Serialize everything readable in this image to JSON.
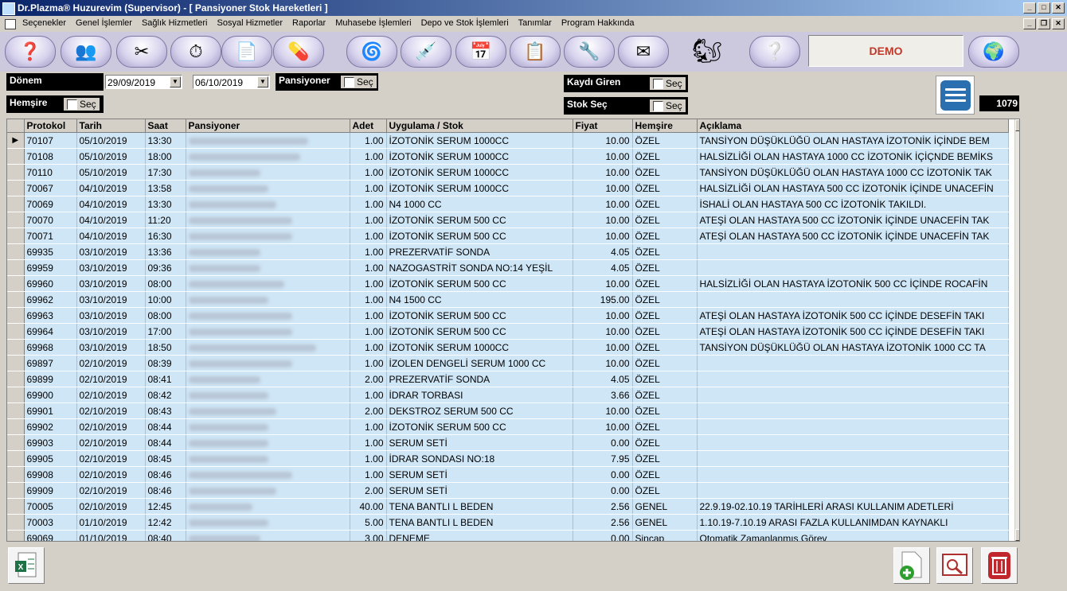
{
  "window": {
    "title": "Dr.Plazma® Huzurevim (Supervisor) - [ Pansiyoner Stok Hareketleri ]"
  },
  "menu": [
    "Seçenekler",
    "Genel İşlemler",
    "Sağlık Hizmetleri",
    "Sosyal Hizmetler",
    "Raporlar",
    "Muhasebe İşlemleri",
    "Depo ve Stok İşlemleri",
    "Tanımlar",
    "Program Hakkında"
  ],
  "toolbar": {
    "demo_label": "DEMO"
  },
  "filters": {
    "donem_label": "Dönem",
    "date_from": "29/09/2019",
    "date_to": "06/10/2019",
    "pansiyoner_label": "Pansiyoner",
    "hemsire_label": "Hemşire",
    "kaydi_giren_label": "Kaydı Giren",
    "stok_sec_label": "Stok Seç",
    "sec_label": "Seç"
  },
  "record_count": "1079",
  "grid": {
    "columns": [
      "Protokol",
      "Tarih",
      "Saat",
      "Pansiyoner",
      "Adet",
      "Uygulama / Stok",
      "Fiyat",
      "Hemşire",
      "Açıklama"
    ],
    "rows": [
      [
        "70107",
        "05/10/2019",
        "13:30",
        "",
        "1.00",
        "İZOTONİK SERUM 1000CC",
        "10.00",
        "ÖZEL",
        "TANSİYON DÜŞÜKLÜĞÜ OLAN HASTAYA İZOTONİK İÇİNDE BEM"
      ],
      [
        "70108",
        "05/10/2019",
        "18:00",
        "",
        "1.00",
        "İZOTONİK SERUM 1000CC",
        "10.00",
        "ÖZEL",
        "HALSİZLİĞİ OLAN HASTAYA 1000 CC İZOTONİK İÇİÇNDE BEMİKS"
      ],
      [
        "70110",
        "05/10/2019",
        "17:30",
        "",
        "1.00",
        "İZOTONİK SERUM 1000CC",
        "10.00",
        "ÖZEL",
        "TANSİYON DÜŞÜKLÜĞÜ OLAN HASTAYA 1000 CC İZOTONİK TAK"
      ],
      [
        "70067",
        "04/10/2019",
        "13:58",
        "",
        "1.00",
        "İZOTONİK SERUM 1000CC",
        "10.00",
        "ÖZEL",
        "HALSİZLİĞİ OLAN HASTAYA 500 CC İZOTONİK İÇİNDE UNACEFİN"
      ],
      [
        "70069",
        "04/10/2019",
        "13:30",
        "",
        "1.00",
        "N4 1000 CC",
        "10.00",
        "ÖZEL",
        "İSHALİ OLAN HASTAYA 500 CC İZOTONİK TAKILDI."
      ],
      [
        "70070",
        "04/10/2019",
        "11:20",
        "",
        "1.00",
        "İZOTONİK SERUM 500 CC",
        "10.00",
        "ÖZEL",
        "ATEŞİ OLAN HASTAYA 500 CC İZOTONİK İÇİNDE UNACEFİN TAK"
      ],
      [
        "70071",
        "04/10/2019",
        "16:30",
        "",
        "1.00",
        "İZOTONİK SERUM 500 CC",
        "10.00",
        "ÖZEL",
        "ATEŞİ OLAN HASTAYA 500 CC İZOTONİK İÇİNDE UNACEFİN TAK"
      ],
      [
        "69935",
        "03/10/2019",
        "13:36",
        "",
        "1.00",
        "PREZERVATİF SONDA",
        "4.05",
        "ÖZEL",
        ""
      ],
      [
        "69959",
        "03/10/2019",
        "09:36",
        "",
        "1.00",
        "NAZOGASTRİT SONDA NO:14 YEŞİL",
        "4.05",
        "ÖZEL",
        ""
      ],
      [
        "69960",
        "03/10/2019",
        "08:00",
        "",
        "1.00",
        "İZOTONİK SERUM 500 CC",
        "10.00",
        "ÖZEL",
        "HALSİZLİĞİ OLAN HASTAYA İZOTONİK 500 CC İÇİNDE ROCAFİN"
      ],
      [
        "69962",
        "03/10/2019",
        "10:00",
        "",
        "1.00",
        "N4 1500 CC",
        "195.00",
        "ÖZEL",
        ""
      ],
      [
        "69963",
        "03/10/2019",
        "08:00",
        "",
        "1.00",
        "İZOTONİK SERUM 500 CC",
        "10.00",
        "ÖZEL",
        "ATEŞİ OLAN HASTAYA İZOTONİK 500 CC İÇİNDE DESEFİN TAKI"
      ],
      [
        "69964",
        "03/10/2019",
        "17:00",
        "",
        "1.00",
        "İZOTONİK SERUM 500 CC",
        "10.00",
        "ÖZEL",
        "ATEŞİ OLAN HASTAYA İZOTONİK 500 CC İÇİNDE DESEFİN TAKI"
      ],
      [
        "69968",
        "03/10/2019",
        "18:50",
        "",
        "1.00",
        "İZOTONİK SERUM 1000CC",
        "10.00",
        "ÖZEL",
        "TANSİYON DÜŞÜKLÜĞÜ OLAN HASTAYA İZOTONİK 1000 CC TA"
      ],
      [
        "69897",
        "02/10/2019",
        "08:39",
        "",
        "1.00",
        "İZOLEN DENGELİ SERUM 1000 CC",
        "10.00",
        "ÖZEL",
        ""
      ],
      [
        "69899",
        "02/10/2019",
        "08:41",
        "",
        "2.00",
        "PREZERVATİF SONDA",
        "4.05",
        "ÖZEL",
        ""
      ],
      [
        "69900",
        "02/10/2019",
        "08:42",
        "",
        "1.00",
        "İDRAR TORBASI",
        "3.66",
        "ÖZEL",
        ""
      ],
      [
        "69901",
        "02/10/2019",
        "08:43",
        "",
        "2.00",
        "DEKSTROZ SERUM 500 CC",
        "10.00",
        "ÖZEL",
        ""
      ],
      [
        "69902",
        "02/10/2019",
        "08:44",
        "",
        "1.00",
        "İZOTONİK SERUM 500 CC",
        "10.00",
        "ÖZEL",
        ""
      ],
      [
        "69903",
        "02/10/2019",
        "08:44",
        "",
        "1.00",
        "SERUM SETİ",
        "0.00",
        "ÖZEL",
        ""
      ],
      [
        "69905",
        "02/10/2019",
        "08:45",
        "",
        "1.00",
        "İDRAR SONDASI NO:18",
        "7.95",
        "ÖZEL",
        ""
      ],
      [
        "69908",
        "02/10/2019",
        "08:46",
        "",
        "1.00",
        "SERUM SETİ",
        "0.00",
        "ÖZEL",
        ""
      ],
      [
        "69909",
        "02/10/2019",
        "08:46",
        "",
        "2.00",
        "SERUM SETİ",
        "0.00",
        "ÖZEL",
        ""
      ],
      [
        "70005",
        "02/10/2019",
        "12:45",
        "",
        "40.00",
        "TENA BANTLI L BEDEN",
        "2.56",
        "GENEL",
        "22.9.19-02.10.19 TARİHLERİ ARASI KULLANIM ADETLERİ"
      ],
      [
        "70003",
        "01/10/2019",
        "12:42",
        "",
        "5.00",
        "TENA BANTLI L BEDEN",
        "2.56",
        "GENEL",
        "1.10.19-7.10.19 ARASI FAZLA KULLANIMDAN KAYNAKLI"
      ],
      [
        "69069",
        "01/10/2019",
        "08:40",
        "",
        "3.00",
        "DENEME",
        "0.00",
        "Sincap",
        "Otomatik Zamanlanmış Görev"
      ]
    ]
  }
}
